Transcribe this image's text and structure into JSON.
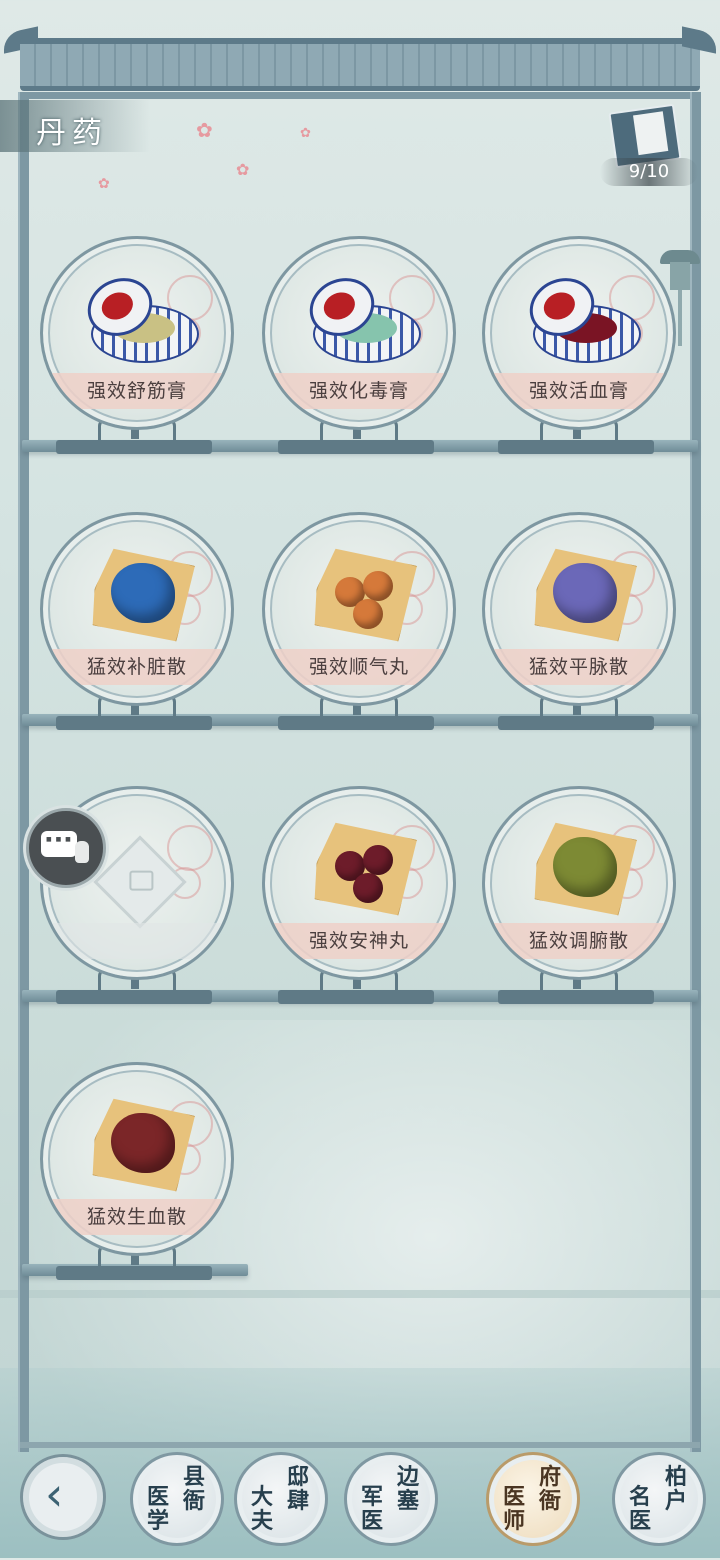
{
  "title": "丹药",
  "counter": "9/10",
  "slots": [
    {
      "label": "强效舒筋膏",
      "kind": "ointment",
      "color": "#c9c184"
    },
    {
      "label": "强效化毒膏",
      "kind": "ointment",
      "color": "#86c4ad"
    },
    {
      "label": "强效活血膏",
      "kind": "ointment",
      "color": "#7a1424"
    },
    {
      "label": "猛效补脏散",
      "kind": "powder",
      "color": "#2d6bb8"
    },
    {
      "label": "强效顺气丸",
      "kind": "pills",
      "color": "#d5793a"
    },
    {
      "label": "猛效平脉散",
      "kind": "powder",
      "color": "#6b68b8"
    },
    {
      "label": "",
      "kind": "locked",
      "color": "#e4eaea"
    },
    {
      "label": "强效安神丸",
      "kind": "pills",
      "color": "#6d1c2a"
    },
    {
      "label": "猛效调腑散",
      "kind": "powder",
      "color": "#7d8a34"
    },
    {
      "label": "猛效生血散",
      "kind": "powder",
      "color": "#7b2628"
    }
  ],
  "nav": {
    "back_icon": "chevron-left-icon",
    "tabs": [
      {
        "a": "县衙",
        "b": "医学"
      },
      {
        "a": "邸肆",
        "b": "大夫"
      },
      {
        "a": "边塞",
        "b": "军医"
      },
      {
        "a": "府衙",
        "b": "医师"
      },
      {
        "a": "柏户",
        "b": "名医"
      }
    ],
    "active_index": 3
  },
  "colors": {
    "frame": "#7d98a3",
    "label_bg": "#efd0c8",
    "accent_active": "#ecd9b8"
  }
}
